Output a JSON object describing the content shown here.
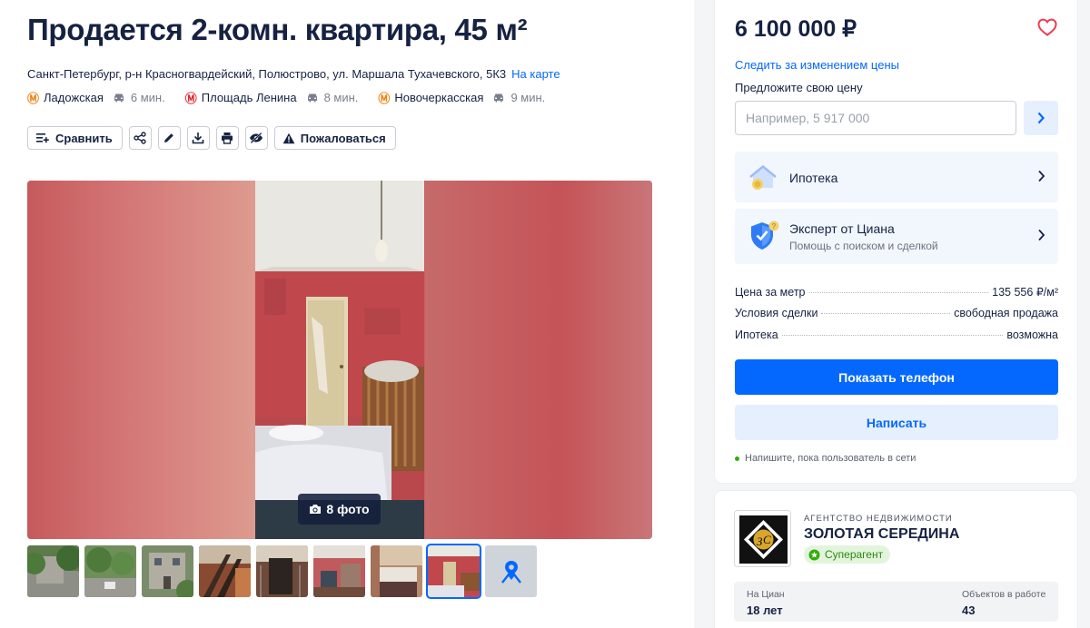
{
  "listing": {
    "title": "Продается 2-комн. квартира, 45 м²",
    "address": "Санкт-Петербург, р-н Красногвардейский, Полюстрово, ул. Маршала Тухачевского, 5К3",
    "map_link": "На карте",
    "metro": [
      {
        "name": "Ладожская",
        "time": "6 мин.",
        "color": "#f07d0a"
      },
      {
        "name": "Площадь Ленина",
        "time": "8 мин.",
        "color": "#e4202a"
      },
      {
        "name": "Новочеркасская",
        "time": "9 мин.",
        "color": "#f07d0a"
      }
    ]
  },
  "toolbar": {
    "compare_label": "Сравнить",
    "complain_label": "Пожаловаться",
    "icons": [
      "share-icon",
      "edit-icon",
      "download-icon",
      "print-icon",
      "hide-icon"
    ]
  },
  "gallery": {
    "photo_count_label": "8 фото",
    "thumbnails_count": 8,
    "active_thumbnail": 8
  },
  "sidebar": {
    "price": "6 100 000 ₽",
    "follow_price": "Следить за изменением цены",
    "offer_label": "Предложите свою цену",
    "offer_placeholder": "Например, 5 917 000",
    "mortgage": {
      "title": "Ипотека"
    },
    "expert": {
      "title": "Эксперт от Циана",
      "subtitle": "Помощь с поиском и сделкой"
    },
    "facts": [
      {
        "key": "Цена за метр",
        "value": "135 556 ₽/м²"
      },
      {
        "key": "Условия сделки",
        "value": "свободная продажа"
      },
      {
        "key": "Ипотека",
        "value": "возможна"
      }
    ],
    "show_phone": "Показать телефон",
    "write": "Написать",
    "online_note": "Напишите, пока пользователь в сети"
  },
  "agent": {
    "type": "АГЕНТСТВО НЕДВИЖИМОСТИ",
    "name": "ЗОЛОТАЯ СЕРЕДИНА",
    "badge": "Суперагент",
    "stats": [
      {
        "label": "На Циан",
        "value": "18 лет"
      },
      {
        "label": "Объектов в работе",
        "value": "43"
      }
    ]
  },
  "colors": {
    "accent": "#0468ff",
    "text": "#152242",
    "superagent": "#34ac0a"
  }
}
